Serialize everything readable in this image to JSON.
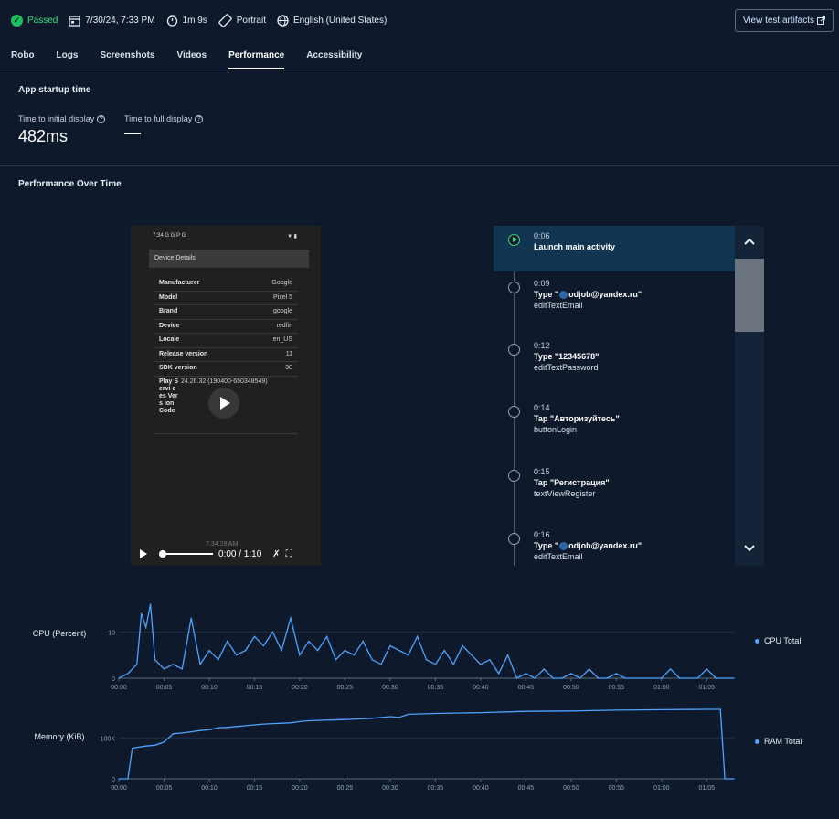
{
  "header": {
    "status": "Passed",
    "date": "7/30/24, 7:33 PM",
    "duration": "1m 9s",
    "orientation": "Portrait",
    "locale": "English (United States)",
    "artifacts_button": "View test artifacts"
  },
  "tabs": [
    "Robo",
    "Logs",
    "Screenshots",
    "Videos",
    "Performance",
    "Accessibility"
  ],
  "active_tab": "Performance",
  "startup": {
    "title": "App startup time",
    "initial_label": "Time to initial display",
    "initial_value": "482ms",
    "full_label": "Time to full display",
    "full_value": "—"
  },
  "perf_title": "Performance Over Time",
  "video": {
    "phone_clock": "7:34 G G P G",
    "phone_battery": "▼ ▮",
    "screen_title": "Device Details",
    "rows": [
      {
        "k": "Manufacturer",
        "v": "Google"
      },
      {
        "k": "Model",
        "v": "Pixel 5"
      },
      {
        "k": "Brand",
        "v": "google"
      },
      {
        "k": "Device",
        "v": "redfin"
      },
      {
        "k": "Locale",
        "v": "en_US"
      },
      {
        "k": "Release version",
        "v": "11"
      },
      {
        "k": "SDK version",
        "v": "30"
      }
    ],
    "play_key": "Play Servi ces Vers ion Code",
    "play_value": "24.26.32 (190400-650348549)",
    "timestamp": "7:34:28 AM",
    "time": "0:00 / 1:10"
  },
  "timeline": [
    {
      "time": "0:06",
      "action": "Launch main activity",
      "target": ""
    },
    {
      "time": "0:09",
      "action_pre": "Type \"",
      "action_post": "odjob@yandex.ru\"",
      "target": "editTextEmail"
    },
    {
      "time": "0:12",
      "action": "Type \"12345678\"",
      "target": "editTextPassword"
    },
    {
      "time": "0:14",
      "action": "Tap \"Авторизуйтесь\"",
      "target": "buttonLogin"
    },
    {
      "time": "0:15",
      "action": "Tap \"Регистрация\"",
      "target": "textViewRegister"
    },
    {
      "time": "0:16",
      "action_pre": "Type \"",
      "action_post": "odjob@yandex.ru\"",
      "target": "editTextEmail"
    }
  ],
  "colors": {
    "line": "#4da3ff",
    "pass": "#3ddc84",
    "bg": "#0e1a2b"
  },
  "chart_data": [
    {
      "type": "line",
      "ylabel": "CPU (Percent)",
      "legend": "CPU Total",
      "ylim": [
        0,
        15
      ],
      "yticks": [
        0,
        10
      ],
      "xticks": [
        "00:00",
        "00:05",
        "00:10",
        "00:15",
        "00:20",
        "00:25",
        "00:30",
        "00:35",
        "00:40",
        "00:45",
        "00:50",
        "00:55",
        "01:00",
        "01:05"
      ],
      "x": [
        0,
        1,
        2,
        2.5,
        3,
        3.5,
        4,
        5,
        6,
        7,
        8,
        9,
        10,
        11,
        12,
        13,
        14,
        15,
        16,
        17,
        18,
        19,
        20,
        21,
        22,
        23,
        24,
        25,
        26,
        27,
        28,
        29,
        30,
        31,
        32,
        33,
        34,
        35,
        36,
        37,
        38,
        39,
        40,
        41,
        42,
        43,
        44,
        45,
        46,
        47,
        48,
        49,
        50,
        51,
        52,
        53,
        54,
        55,
        56,
        57,
        58,
        59,
        60,
        61,
        62,
        63,
        64,
        65,
        66,
        67,
        68
      ],
      "y": [
        0,
        1,
        3,
        14,
        11,
        16,
        4,
        2,
        3,
        2,
        13,
        3,
        6,
        4,
        8,
        5,
        6,
        9,
        7,
        10,
        6,
        13,
        5,
        8,
        6,
        9,
        4,
        6,
        5,
        8,
        4,
        3,
        7,
        6,
        5,
        9,
        4,
        3,
        6,
        3,
        7,
        5,
        3,
        4,
        1,
        5,
        0,
        1,
        0,
        2,
        0,
        0,
        1,
        0,
        2,
        0,
        0,
        1,
        0,
        0,
        0,
        0,
        0,
        2,
        0,
        0,
        0,
        2,
        0,
        0,
        0
      ],
      "note": "values approximate"
    },
    {
      "type": "line",
      "ylabel": "Memory (KiB)",
      "legend": "RAM Total",
      "ylim": [
        0,
        170000
      ],
      "yticks": [
        0,
        100000
      ],
      "ytick_labels": [
        "0",
        "100K"
      ],
      "xticks": [
        "00:00",
        "00:05",
        "00:10",
        "00:15",
        "00:20",
        "00:25",
        "00:30",
        "00:35",
        "00:40",
        "00:45",
        "00:50",
        "00:55",
        "01:00",
        "01:05"
      ],
      "x": [
        0,
        1,
        1.5,
        3,
        4,
        5,
        6,
        7,
        8,
        9,
        10,
        11,
        12,
        13,
        14,
        15,
        16,
        17,
        18,
        19,
        20,
        21,
        22,
        25,
        28,
        30,
        31,
        32,
        35,
        40,
        45,
        50,
        55,
        60,
        65,
        66.5,
        67,
        68
      ],
      "y": [
        0,
        0,
        75000,
        80000,
        82000,
        90000,
        110000,
        112000,
        115000,
        118000,
        120000,
        125000,
        126000,
        128000,
        130000,
        132000,
        134000,
        135000,
        136000,
        137000,
        140000,
        142000,
        143000,
        145000,
        148000,
        152000,
        150000,
        158000,
        160000,
        162000,
        165000,
        166000,
        168000,
        169000,
        170000,
        170000,
        0,
        0
      ],
      "note": "values approximate"
    }
  ]
}
